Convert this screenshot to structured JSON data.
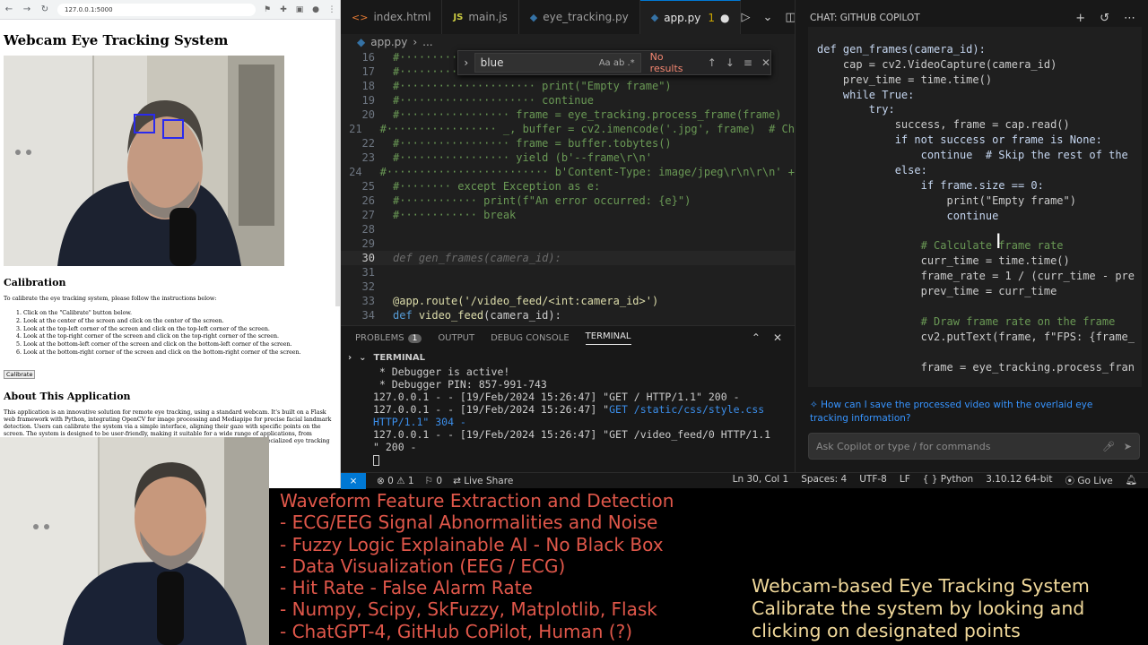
{
  "browser": {
    "url": "127.0.0.1:5000",
    "page_title": "Webcam Eye Tracking System",
    "calibration_heading": "Calibration",
    "calibration_intro": "To calibrate the eye tracking system, please follow the instructions below:",
    "steps": [
      "Click on the \"Calibrate\" button below.",
      "Look at the center of the screen and click on the center of the screen.",
      "Look at the top-left corner of the screen and click on the top-left corner of the screen.",
      "Look at the top-right corner of the screen and click on the top-right corner of the screen.",
      "Look at the bottom-left corner of the screen and click on the bottom-left corner of the screen.",
      "Look at the bottom-right corner of the screen and click on the bottom-right corner of the screen."
    ],
    "calibrate_button": "Calibrate",
    "about_heading": "About This Application",
    "about_text": "This application is an innovative solution for remote eye tracking, using a standard webcam. It's built on a Flask web framework with Python, integrating OpenCV for image processing and Mediapipe for precise facial landmark detection. Users can calibrate the system via a simple interface, aligning their gaze with specific points on the screen. The system is designed to be user-friendly, making it suitable for a wide range of applications, from telemedicine to cognitive research. It demonstrates reliable performance, comparable to specialized eye tracking equipment. Our optimization for remote use."
  },
  "editor": {
    "tabs": [
      {
        "label": "index.html",
        "icon": "html-icon"
      },
      {
        "label": "main.js",
        "icon": "js-icon"
      },
      {
        "label": "eye_tracking.py",
        "icon": "python-icon"
      },
      {
        "label": "app.py",
        "icon": "python-icon",
        "modified": "1"
      }
    ],
    "breadcrumb": "app.py",
    "breadcrumb_more": "...",
    "find": {
      "query": "blue",
      "options": "Aa  ab  .*",
      "result": "No results"
    },
    "lines": [
      {
        "n": "16",
        "t": "#····································",
        "cls": "c-cm"
      },
      {
        "n": "17",
        "t": "#····································",
        "cls": "c-cm"
      },
      {
        "n": "18",
        "t": "#····················· print(\"Empty frame\")",
        "cls": "c-cm"
      },
      {
        "n": "19",
        "t": "#····················· continue",
        "cls": "c-cm"
      },
      {
        "n": "20",
        "t": "#················· frame = eye_tracking.process_frame(frame)",
        "cls": "c-cm"
      },
      {
        "n": "21",
        "t": "#················· _, buffer = cv2.imencode('.jpg', frame)  # Ch",
        "cls": "c-cm"
      },
      {
        "n": "22",
        "t": "#················· frame = buffer.tobytes()",
        "cls": "c-cm"
      },
      {
        "n": "23",
        "t": "#················· yield (b'--frame\\r\\n'",
        "cls": "c-cm"
      },
      {
        "n": "24",
        "t": "#························· b'Content-Type: image/jpeg\\r\\n\\r\\n' +",
        "cls": "c-cm"
      },
      {
        "n": "25",
        "t": "#········ except Exception as e:",
        "cls": "c-cm"
      },
      {
        "n": "26",
        "t": "#············ print(f\"An error occurred: {e}\")",
        "cls": "c-cm"
      },
      {
        "n": "27",
        "t": "#············ break",
        "cls": "c-cm"
      },
      {
        "n": "28",
        "t": "",
        "cls": ""
      },
      {
        "n": "29",
        "t": "",
        "cls": ""
      },
      {
        "n": "30",
        "t": "def gen_frames(camera_id):",
        "cls": "c-ghost",
        "current": true
      },
      {
        "n": "31",
        "t": "",
        "cls": ""
      },
      {
        "n": "32",
        "t": "",
        "cls": ""
      },
      {
        "n": "33",
        "t": "@app.route('/video_feed/<int:camera_id>')",
        "cls": "c-de"
      },
      {
        "n": "34",
        "t": "def video_feed(camera_id):",
        "cls": "c-mix"
      }
    ],
    "panel": {
      "tabs": [
        "PROBLEMS",
        "OUTPUT",
        "DEBUG CONSOLE",
        "TERMINAL"
      ],
      "problems_count": "1",
      "terminal_label": "TERMINAL",
      "terminal_lines": [
        " * Debugger is active!",
        " * Debugger PIN: 857-991-743",
        "127.0.0.1 - - [19/Feb/2024 15:26:47] \"GET / HTTP/1.1\" 200 -",
        "127.0.0.1 - - [19/Feb/2024 15:26:47] \"GET /static/css/style.css",
        "HTTP/1.1\" 304 -",
        "127.0.0.1 - - [19/Feb/2024 15:26:47] \"GET /video_feed/0 HTTP/1.1",
        "\" 200 -"
      ]
    }
  },
  "status_bar": {
    "errors": "0",
    "warnings": "1",
    "info": "0",
    "live_share": "Live Share",
    "position": "Ln 30, Col 1",
    "spaces": "Spaces: 4",
    "encoding": "UTF-8",
    "eol": "LF",
    "language": "Python",
    "interpreter": "3.10.12 64-bit",
    "golive": "Go Live"
  },
  "chat": {
    "title": "CHAT: GITHUB COPILOT",
    "code": [
      "",
      "def gen_frames(camera_id):",
      "    cap = cv2.VideoCapture(camera_id)",
      "    prev_time = time.time()",
      "    while True:",
      "        try:",
      "            success, frame = cap.read()",
      "            if not success or frame is None:",
      "                continue  # Skip the rest of the",
      "            else:",
      "                if frame.size == 0:",
      "                    print(\"Empty frame\")",
      "                    continue",
      "",
      "                # Calculate frame rate",
      "                curr_time = time.time()",
      "                frame_rate = 1 / (curr_time - pre",
      "                prev_time = curr_time",
      "",
      "                # Draw frame rate on the frame",
      "                cv2.putText(frame, f\"FPS: {frame_",
      "",
      "                frame = eye_tracking.process_fran",
      "                "
    ],
    "suggestion": "How can I save the processed video with the overlaid eye tracking information?",
    "input_placeholder": "Ask Copilot or type / for commands"
  },
  "overlay": {
    "left_lines": [
      "Waveform Feature Extraction and Detection",
      "- ECG/EEG Signal Abnormalities and Noise",
      "- Fuzzy Logic Explainable AI - No Black Box",
      "- Data Visualization (EEG / ECG)",
      "- Hit Rate - False Alarm Rate",
      "- Numpy, Scipy, SkFuzzy, Matplotlib, Flask",
      "- ChatGPT-4, GitHub CoPilot, Human (?)"
    ],
    "right_lines": [
      "Webcam-based Eye Tracking System",
      "Calibrate the system by looking and",
      "clicking on designated points"
    ]
  }
}
